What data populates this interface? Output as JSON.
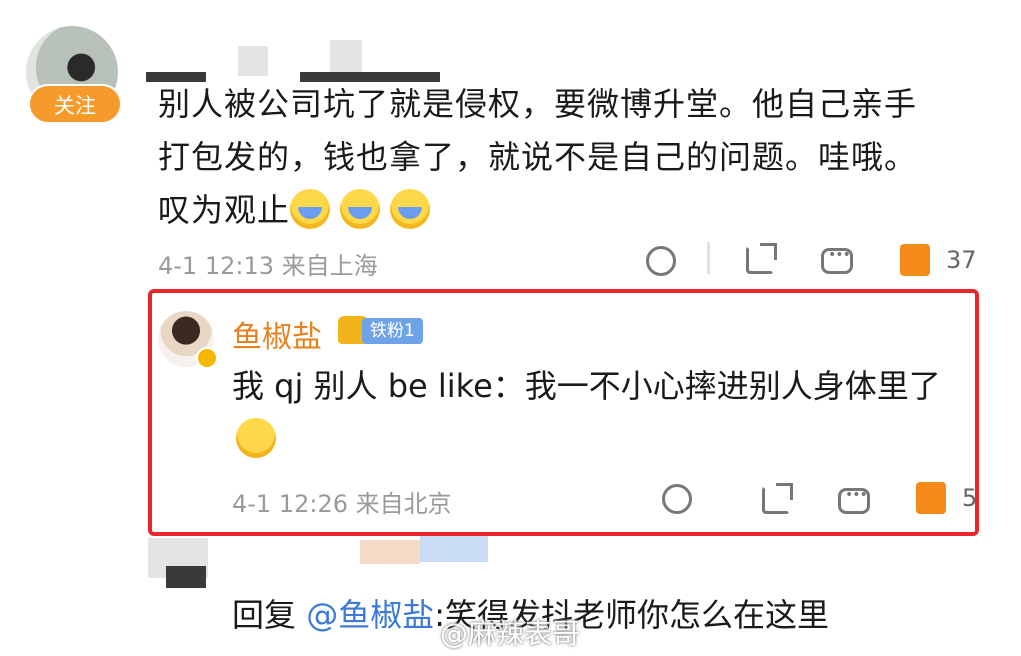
{
  "comment": {
    "follow_label": "关注",
    "text_line1": "别人被公司坑了就是侵权，要微博升堂。他自己亲手",
    "text_line2": "打包发的，钱也拿了，就说不是自己的问题。哇哦。",
    "text_line3": "叹为观止",
    "emoji_icons": [
      "crying-emoji",
      "crying-emoji",
      "crying-emoji"
    ],
    "timestamp": "4-1 12:13",
    "location": "来自上海",
    "like_count": "37"
  },
  "reply": {
    "username": "鱼椒盐",
    "badge": "铁粉1",
    "text": "我 qj 别人 be like：我一不小心摔进别人身体里了",
    "emoji_icon": "shocked-emoji",
    "timestamp": "4-1 12:26",
    "location": "来自北京",
    "like_count": "5"
  },
  "sub_reply": {
    "prefix": "回复 ",
    "mention": "@鱼椒盐",
    "text": ":笑得发抖老师你怎么在这里"
  },
  "watermark": "@麻辣表哥",
  "colors": {
    "accent_orange": "#f38a1a",
    "highlight_red": "#e8272d",
    "mention_blue": "#3b7ad6"
  }
}
